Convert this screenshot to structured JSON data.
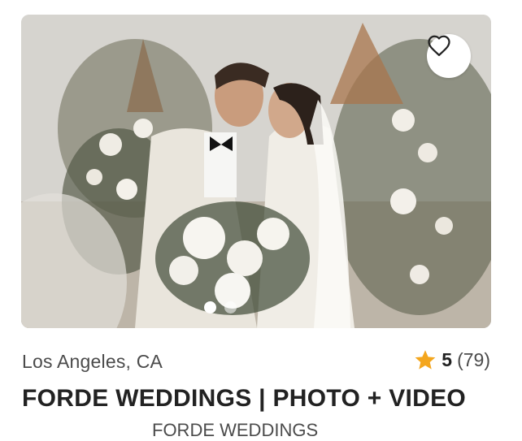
{
  "listing": {
    "location": "Los Angeles, CA",
    "rating": "5",
    "review_count": "(79)",
    "title": "FORDE WEDDINGS | PHOTO + VIDEO",
    "subtitle_partial": "FORDE WEDDINGS"
  },
  "carousel": {
    "slides_visible": 2,
    "active_index": 0
  },
  "icons": {
    "favorite": "heart-outline-icon",
    "rating": "star-icon"
  },
  "colors": {
    "star": "#f4a61d",
    "text_primary": "#222222",
    "text_secondary": "#4b4b4b"
  }
}
